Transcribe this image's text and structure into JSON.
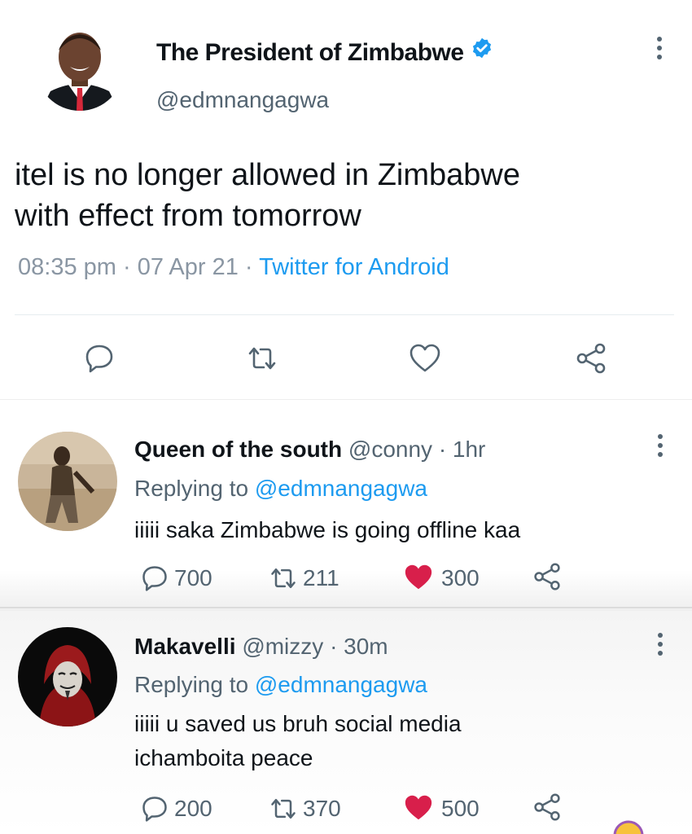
{
  "main_tweet": {
    "author_name": "The President of Zimbabwe",
    "handle": "@edmnangagwa",
    "text_line1": "itel is no longer allowed in Zimbabwe",
    "text_line2": "with effect from tomorrow",
    "time": "08:35 pm",
    "separator": " · ",
    "date": "07 Apr 21",
    "source": "Twitter for Android",
    "icons": [
      "reply-icon",
      "retweet-icon",
      "like-icon",
      "share-icon"
    ]
  },
  "replies": [
    {
      "name": "Queen of the south",
      "handle": "@conny",
      "time": "· 1hr",
      "replying_prefix": "Replying to ",
      "replying_to": "@edmnangagwa",
      "text_lines": [
        "iiiii saka Zimbabwe is going offline kaa"
      ],
      "reply_count": "700",
      "retweet_count": "211",
      "like_count": "300"
    },
    {
      "name": "Makavelli",
      "handle": "@mizzy",
      "time": "· 30m",
      "replying_prefix": "Replying to ",
      "replying_to": "@edmnangagwa",
      "text_lines": [
        "iiiii u saved us bruh social media",
        "ichamboita peace"
      ],
      "reply_count": "200",
      "retweet_count": "370",
      "like_count": "500"
    }
  ],
  "colors": {
    "accent": "#1d9bf0",
    "like": "#e0245e",
    "muted": "#536471"
  }
}
